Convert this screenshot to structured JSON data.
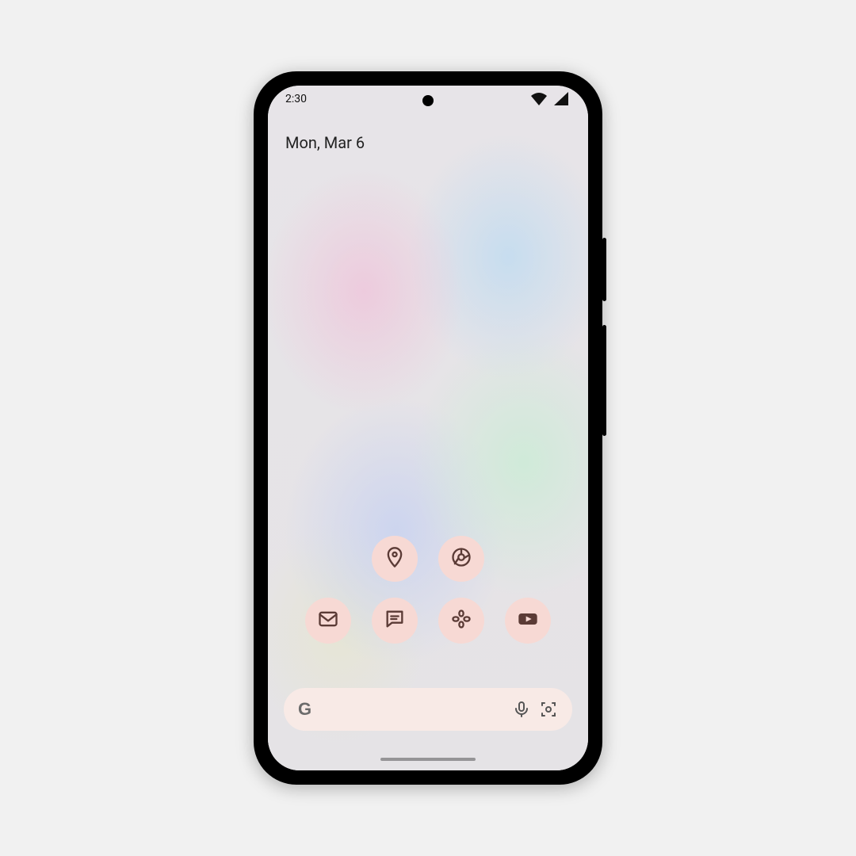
{
  "status": {
    "time": "2:30"
  },
  "date_widget": {
    "label": "Mon, Mar 6"
  },
  "app_row1": [
    {
      "name": "maps-icon"
    },
    {
      "name": "chrome-icon"
    }
  ],
  "app_row2": [
    {
      "name": "gmail-icon"
    },
    {
      "name": "messages-icon"
    },
    {
      "name": "photos-icon"
    },
    {
      "name": "youtube-icon"
    }
  ],
  "search": {
    "logo": "G",
    "placeholder": ""
  },
  "colors": {
    "icon_bg": "#f7d9d4",
    "icon_fg": "#5b3b36",
    "search_bg": "#f8eae6"
  }
}
